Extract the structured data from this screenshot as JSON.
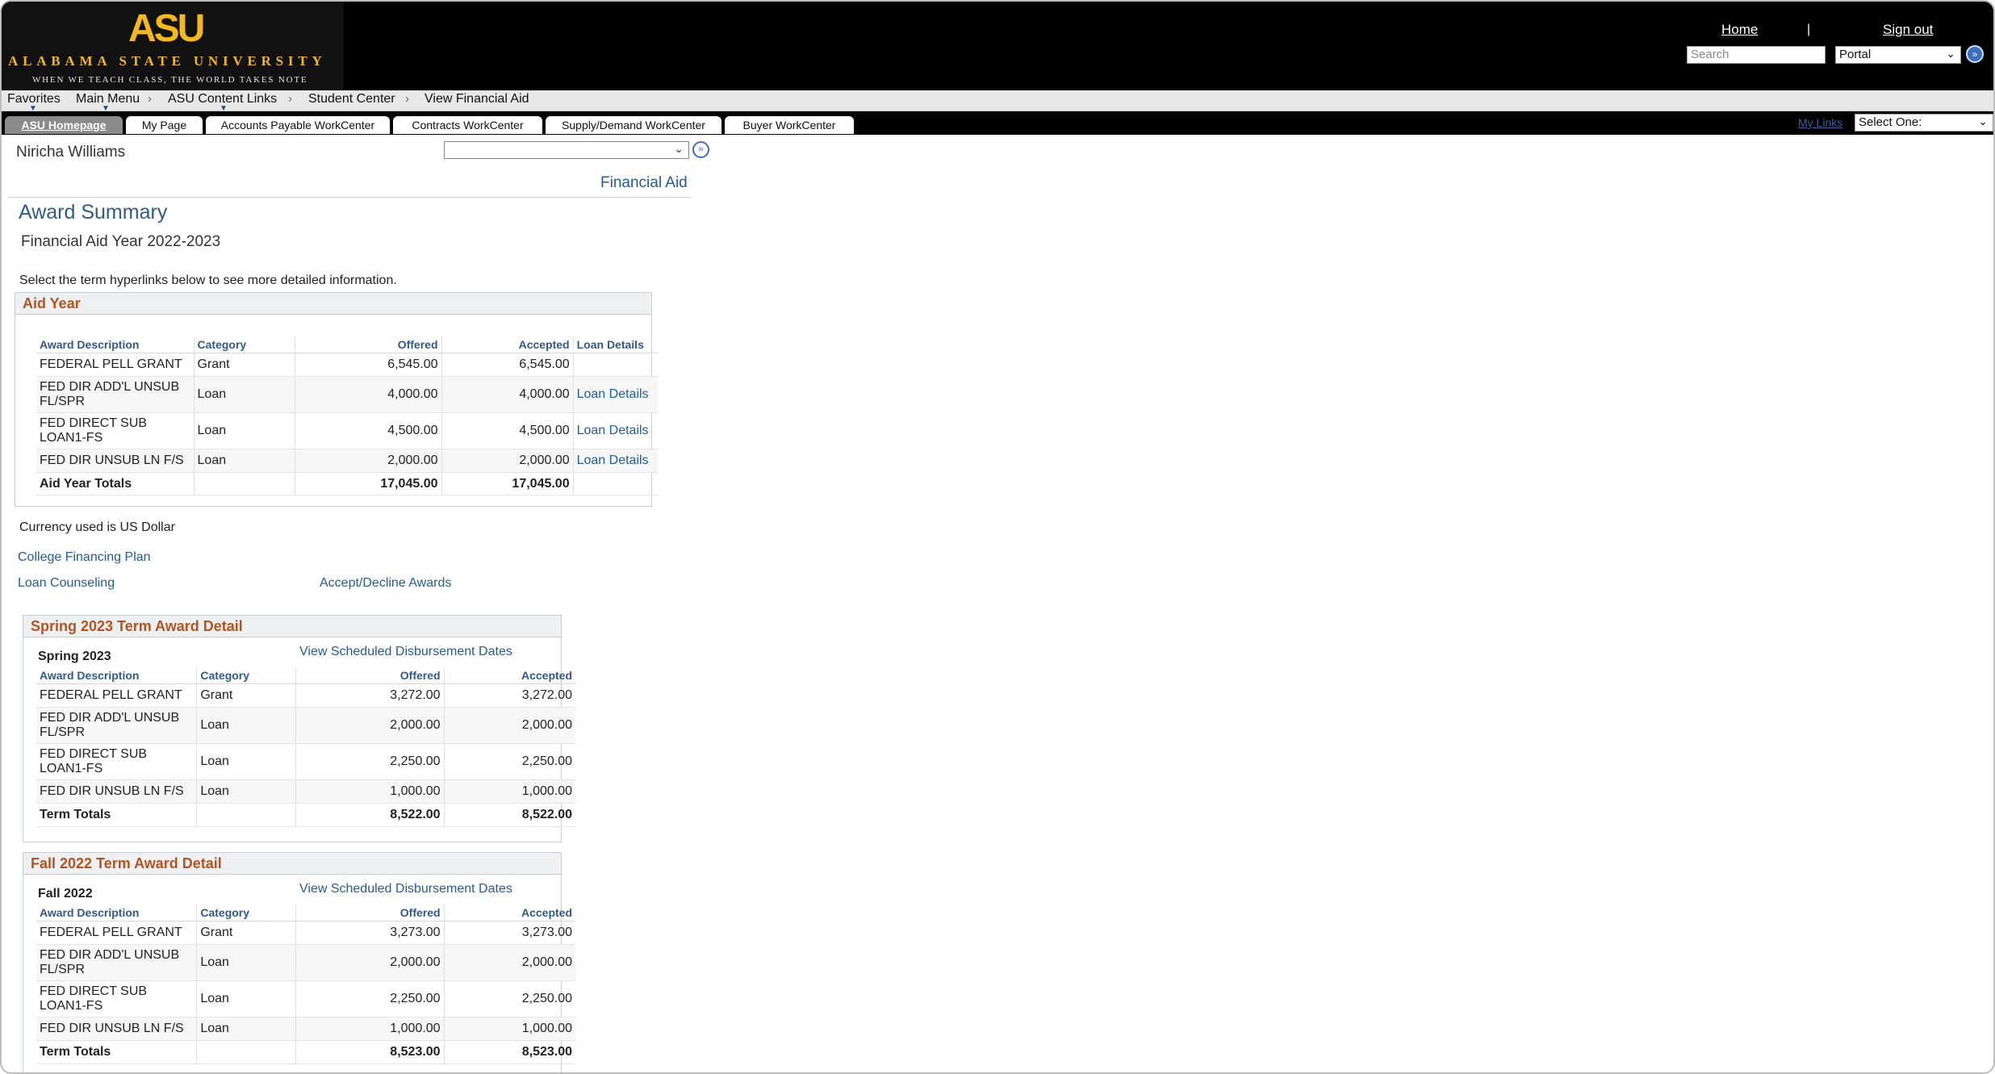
{
  "banner": {
    "logo_mark": "ASU",
    "logo_name": "ALABAMA STATE UNIVERSITY",
    "logo_tagline": "WHEN WE TEACH CLASS, THE WORLD TAKES NOTE",
    "home_link": "Home",
    "separator": "|",
    "signout_link": "Sign out",
    "search_placeholder": "Search",
    "search_scope": "Portal",
    "colors": {
      "background": "#000000",
      "brand_gold": "#f2b81e"
    }
  },
  "breadcrumb": {
    "items": [
      "Favorites",
      "Main Menu",
      "ASU Content Links",
      "Student Center",
      "View Financial Aid"
    ]
  },
  "tabs": {
    "items": [
      "ASU Homepage",
      "My Page",
      "Accounts Payable WorkCenter",
      "Contracts WorkCenter",
      "Supply/Demand WorkCenter",
      "Buyer WorkCenter"
    ],
    "active": "ASU Homepage",
    "my_links": "My Links",
    "my_links_select": "Select One:"
  },
  "content": {
    "user_name": "Niricha Williams",
    "financial_aid_link": "Financial Aid",
    "page_title": "Award Summary",
    "aid_year_title": "Financial Aid Year 2022-2023",
    "instructions": "Select the term hyperlinks below to see more detailed information.",
    "currency_note": "Currency used is US Dollar",
    "college_financing_plan": "College Financing Plan",
    "loan_counseling": "Loan Counseling",
    "accept_decline": "Accept/Decline Awards"
  },
  "aid_year_grid": {
    "title": "Aid Year",
    "headers": [
      "Award Description",
      "Category",
      "Offered",
      "Accepted",
      "Loan Details"
    ],
    "rows": [
      {
        "desc": "FEDERAL PELL GRANT",
        "category": "Grant",
        "offered": "6,545.00",
        "accepted": "6,545.00",
        "loan": ""
      },
      {
        "desc": "FED DIR ADD'L UNSUB FL/SPR",
        "category": "Loan",
        "offered": "4,000.00",
        "accepted": "4,000.00",
        "loan": "Loan Details"
      },
      {
        "desc": "FED DIRECT SUB LOAN1-FS",
        "category": "Loan",
        "offered": "4,500.00",
        "accepted": "4,500.00",
        "loan": "Loan Details"
      },
      {
        "desc": "FED DIR UNSUB LN F/S",
        "category": "Loan",
        "offered": "2,000.00",
        "accepted": "2,000.00",
        "loan": "Loan Details"
      }
    ],
    "total": {
      "label": "Aid Year Totals",
      "offered": "17,045.00",
      "accepted": "17,045.00"
    }
  },
  "spring_term": {
    "title": "Spring 2023 Term Award Detail",
    "term": "Spring 2023",
    "disbursement_link": "View Scheduled Disbursement Dates",
    "headers": [
      "Award Description",
      "Category",
      "Offered",
      "Accepted"
    ],
    "rows": [
      {
        "desc": "FEDERAL PELL GRANT",
        "category": "Grant",
        "offered": "3,272.00",
        "accepted": "3,272.00"
      },
      {
        "desc": "FED DIR ADD'L UNSUB FL/SPR",
        "category": "Loan",
        "offered": "2,000.00",
        "accepted": "2,000.00"
      },
      {
        "desc": "FED DIRECT SUB LOAN1-FS",
        "category": "Loan",
        "offered": "2,250.00",
        "accepted": "2,250.00"
      },
      {
        "desc": "FED DIR UNSUB LN F/S",
        "category": "Loan",
        "offered": "1,000.00",
        "accepted": "1,000.00"
      }
    ],
    "total": {
      "label": "Term Totals",
      "offered": "8,522.00",
      "accepted": "8,522.00"
    }
  },
  "fall_term": {
    "title": "Fall 2022 Term Award Detail",
    "term": "Fall 2022",
    "disbursement_link": "View Scheduled Disbursement Dates",
    "headers": [
      "Award Description",
      "Category",
      "Offered",
      "Accepted"
    ],
    "rows": [
      {
        "desc": "FEDERAL PELL GRANT",
        "category": "Grant",
        "offered": "3,273.00",
        "accepted": "3,273.00"
      },
      {
        "desc": "FED DIR ADD'L UNSUB FL/SPR",
        "category": "Loan",
        "offered": "2,000.00",
        "accepted": "2,000.00"
      },
      {
        "desc": "FED DIRECT SUB LOAN1-FS",
        "category": "Loan",
        "offered": "2,250.00",
        "accepted": "2,250.00"
      },
      {
        "desc": "FED DIR UNSUB LN F/S",
        "category": "Loan",
        "offered": "1,000.00",
        "accepted": "1,000.00"
      }
    ],
    "total": {
      "label": "Term Totals",
      "offered": "8,523.00",
      "accepted": "8,523.00"
    }
  }
}
